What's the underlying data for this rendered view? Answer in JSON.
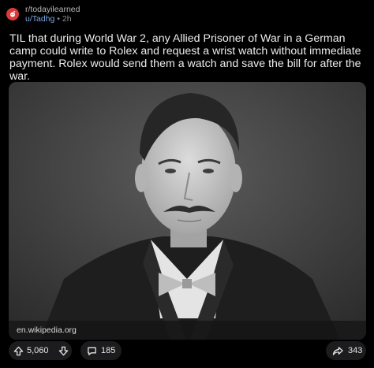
{
  "post": {
    "subreddit": "r/todayilearned",
    "author": "u/Tadhg",
    "separator": "•",
    "age": "2h",
    "title": "TIL that during World War 2, any Allied Prisoner of War in a German camp could write to Rolex and request a wrist watch without immediate payment. Rolex would send them a watch and save the bill for after the war.",
    "link_domain": "en.wikipedia.org"
  },
  "actions": {
    "upvotes": "5,060",
    "comments": "185",
    "shares": "343"
  },
  "icons": {
    "subreddit": "subreddit-avatar-icon",
    "upvote": "upvote-arrow-icon",
    "downvote": "downvote-arrow-icon",
    "comment": "comment-bubble-icon",
    "share": "share-arrow-icon"
  },
  "colors": {
    "background": "#000000",
    "subreddit_avatar": "#d93a3a",
    "author": "#7aa6e0",
    "pill": "#1c1c1e"
  }
}
